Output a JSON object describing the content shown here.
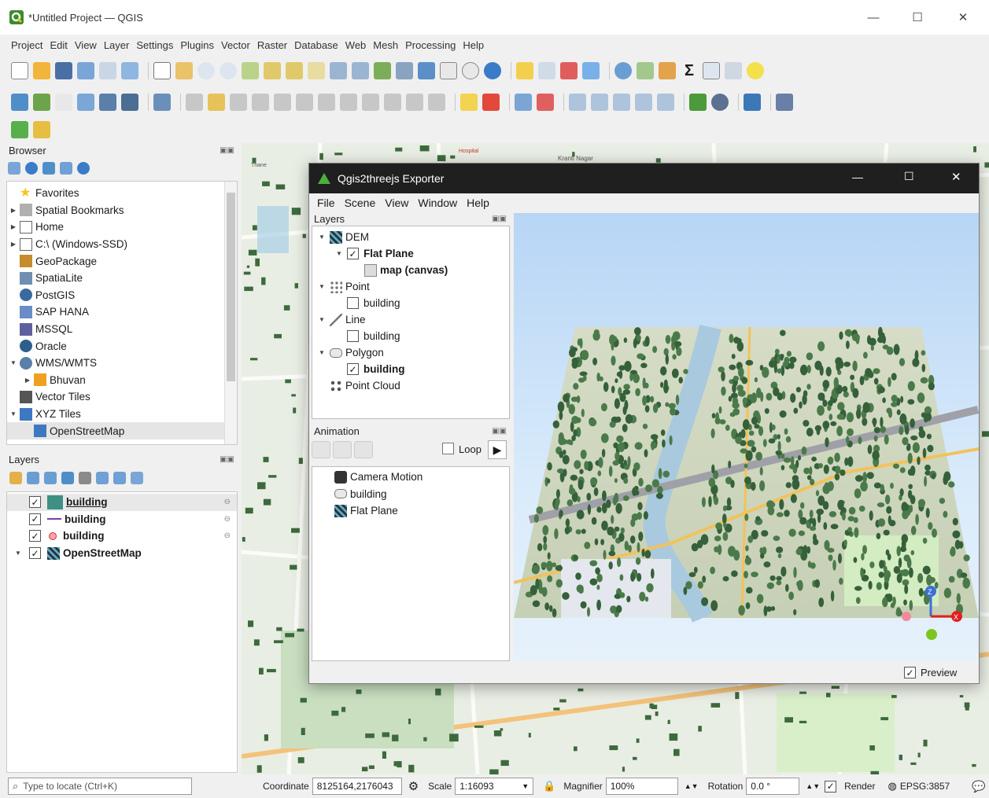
{
  "app": {
    "title": "*Untitled Project — QGIS",
    "menu": [
      "Project",
      "Edit",
      "View",
      "Layer",
      "Settings",
      "Plugins",
      "Vector",
      "Raster",
      "Database",
      "Web",
      "Mesh",
      "Processing",
      "Help"
    ],
    "accent": "#3d8b2c"
  },
  "browser": {
    "title": "Browser",
    "items": [
      {
        "label": "Favorites",
        "icon": "star-icon",
        "arrow": ""
      },
      {
        "label": "Spatial Bookmarks",
        "icon": "bookmark-icon",
        "arrow": "▶"
      },
      {
        "label": "Home",
        "icon": "home-icon",
        "arrow": "▶"
      },
      {
        "label": "C:\\ (Windows-SSD)",
        "icon": "drive-icon",
        "arrow": "▶"
      },
      {
        "label": "GeoPackage",
        "icon": "geopackage-icon",
        "arrow": ""
      },
      {
        "label": "SpatiaLite",
        "icon": "feather-icon",
        "arrow": ""
      },
      {
        "label": "PostGIS",
        "icon": "elephant-icon",
        "arrow": ""
      },
      {
        "label": "SAP HANA",
        "icon": "database-icon",
        "arrow": ""
      },
      {
        "label": "MSSQL",
        "icon": "mssql-icon",
        "arrow": ""
      },
      {
        "label": "Oracle",
        "icon": "oracle-icon",
        "arrow": ""
      },
      {
        "label": "WMS/WMTS",
        "icon": "globe-icon",
        "arrow": "▼"
      },
      {
        "label": "Bhuvan",
        "icon": "server-icon",
        "arrow": "▶"
      },
      {
        "label": "Vector Tiles",
        "icon": "grid-icon",
        "arrow": ""
      },
      {
        "label": "XYZ Tiles",
        "icon": "tiles-icon",
        "arrow": "▼"
      },
      {
        "label": "OpenStreetMap",
        "icon": "tiles-icon",
        "arrow": ""
      }
    ]
  },
  "layers": {
    "title": "Layers",
    "items": [
      {
        "label": "building",
        "type": "polygon",
        "checked": "✓"
      },
      {
        "label": "building",
        "type": "line",
        "checked": "✓"
      },
      {
        "label": "building",
        "type": "point",
        "checked": "✓"
      },
      {
        "label": "OpenStreetMap",
        "type": "raster",
        "checked": "✓"
      }
    ]
  },
  "dialog": {
    "title": "Qgis2threejs Exporter",
    "menu": [
      "File",
      "Scene",
      "View",
      "Window",
      "Help"
    ],
    "layers_title": "Layers",
    "tree": [
      {
        "label": "DEM",
        "depth": 0,
        "arrow": "▼",
        "check": "",
        "icon": "dem-icon",
        "bold": false
      },
      {
        "label": "Flat Plane",
        "depth": 1,
        "arrow": "▼",
        "check": "✓",
        "icon": "",
        "bold": true
      },
      {
        "label": "map (canvas)",
        "depth": 2,
        "arrow": "",
        "check": "",
        "icon": "texture-icon",
        "bold": true
      },
      {
        "label": "Point",
        "depth": 0,
        "arrow": "▼",
        "check": "",
        "icon": "point-icon",
        "bold": false
      },
      {
        "label": "building",
        "depth": 1,
        "arrow": "",
        "check": " ",
        "icon": "",
        "bold": false
      },
      {
        "label": "Line",
        "depth": 0,
        "arrow": "▼",
        "check": "",
        "icon": "line-icon",
        "bold": false
      },
      {
        "label": "building",
        "depth": 1,
        "arrow": "",
        "check": " ",
        "icon": "",
        "bold": false
      },
      {
        "label": "Polygon",
        "depth": 0,
        "arrow": "▼",
        "check": "",
        "icon": "polygon-icon",
        "bold": false
      },
      {
        "label": "building",
        "depth": 1,
        "arrow": "",
        "check": "✓",
        "icon": "",
        "bold": true
      },
      {
        "label": "Point Cloud",
        "depth": 0,
        "arrow": "",
        "check": "",
        "icon": "pointcloud-icon",
        "bold": false
      }
    ],
    "animation_title": "Animation",
    "loop_label": "Loop",
    "animation_items": [
      {
        "label": "Camera Motion",
        "icon": "camera-icon"
      },
      {
        "label": "building",
        "icon": "polygon-icon"
      },
      {
        "label": "Flat Plane",
        "icon": "dem-icon"
      }
    ],
    "preview_label": "Preview",
    "preview_checked": "✓"
  },
  "status": {
    "locate_placeholder": "Type to locate (Ctrl+K)",
    "coordinate_label": "Coordinate",
    "coordinate_value": "8125164,2176043",
    "scale_label": "Scale",
    "scale_value": "1:16093",
    "magnifier_label": "Magnifier",
    "magnifier_value": "100%",
    "rotation_label": "Rotation",
    "rotation_value": "0.0 °",
    "render_label": "Render",
    "render_checked": "✓",
    "crs": "EPSG:3857"
  },
  "map_labels": {
    "hospital": "Hospital",
    "krantinagar": "Kranti Nagar",
    "thane": "Thane"
  }
}
